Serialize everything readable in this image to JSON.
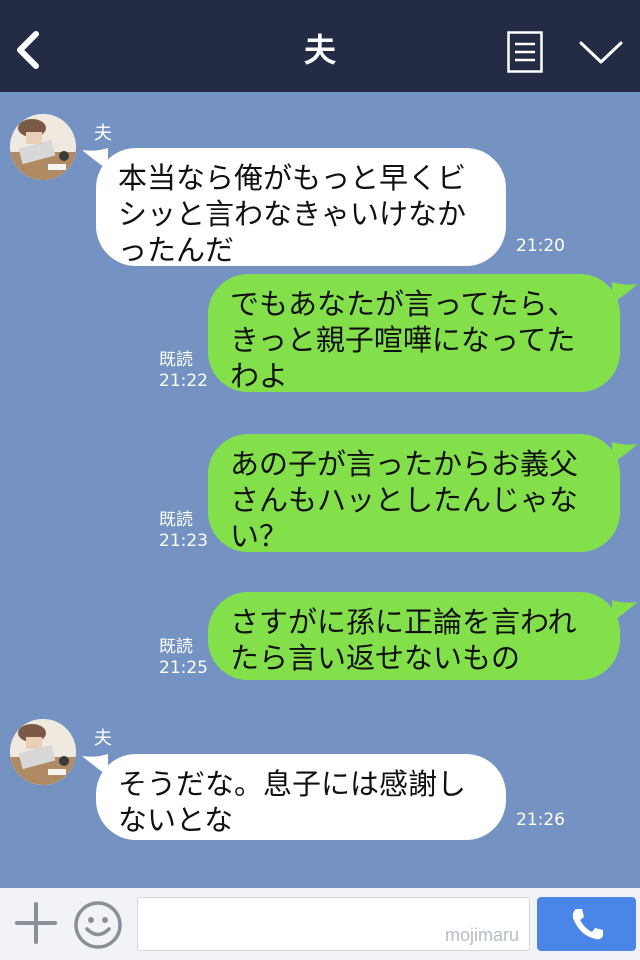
{
  "header": {
    "title": "夫",
    "icons": [
      "back-icon",
      "menu-icon",
      "chevron-down-icon"
    ]
  },
  "messages": [
    {
      "direction": "incoming",
      "sender": "夫",
      "lines": [
        "本当なら俺がもっと早くビ",
        "シッと言わなきゃいけなか",
        "ったんだ"
      ],
      "time": "21:20"
    },
    {
      "direction": "outgoing",
      "read": "既読",
      "lines": [
        "でもあなたが言ってたら、",
        "きっと親子喧嘩になってた",
        "わよ"
      ],
      "time": "21:22"
    },
    {
      "direction": "outgoing",
      "read": "既読",
      "lines": [
        "あの子が言ったからお義父",
        "さんもハッとしたんじゃな",
        "い？"
      ],
      "time": "21:23"
    },
    {
      "direction": "outgoing",
      "read": "既読",
      "lines": [
        "さすがに孫に正論を言われ",
        "たら言い返せないもの"
      ],
      "time": "21:25"
    },
    {
      "direction": "incoming",
      "sender": "夫",
      "lines": [
        "そうだな。息子には感謝し",
        "ないとな"
      ],
      "time": "21:26"
    }
  ],
  "input_bar": {
    "input_value": "",
    "watermark": "mojimaru",
    "icons": [
      "plus-icon",
      "smile-icon",
      "phone-icon"
    ]
  },
  "colors": {
    "header_bg": "#232c44",
    "chat_bg": "#7493c2",
    "incoming_bubble": "#ffffff",
    "outgoing_bubble": "#84e04a",
    "call_button": "#4a86e8"
  }
}
